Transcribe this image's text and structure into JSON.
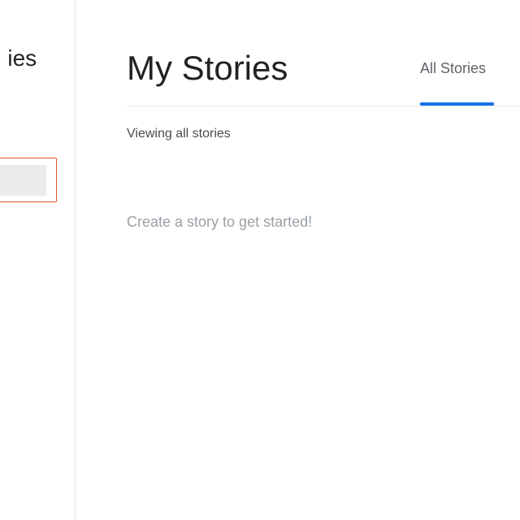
{
  "sidebar": {
    "title_fragment": "ies"
  },
  "main": {
    "title": "My Stories",
    "tabs": [
      {
        "label": "All Stories",
        "active": true
      }
    ],
    "filter_text": "Viewing all stories",
    "empty_message": "Create a story to get started!"
  },
  "colors": {
    "accent_underline": "#1a73e8",
    "focus_border": "#e0572d"
  }
}
